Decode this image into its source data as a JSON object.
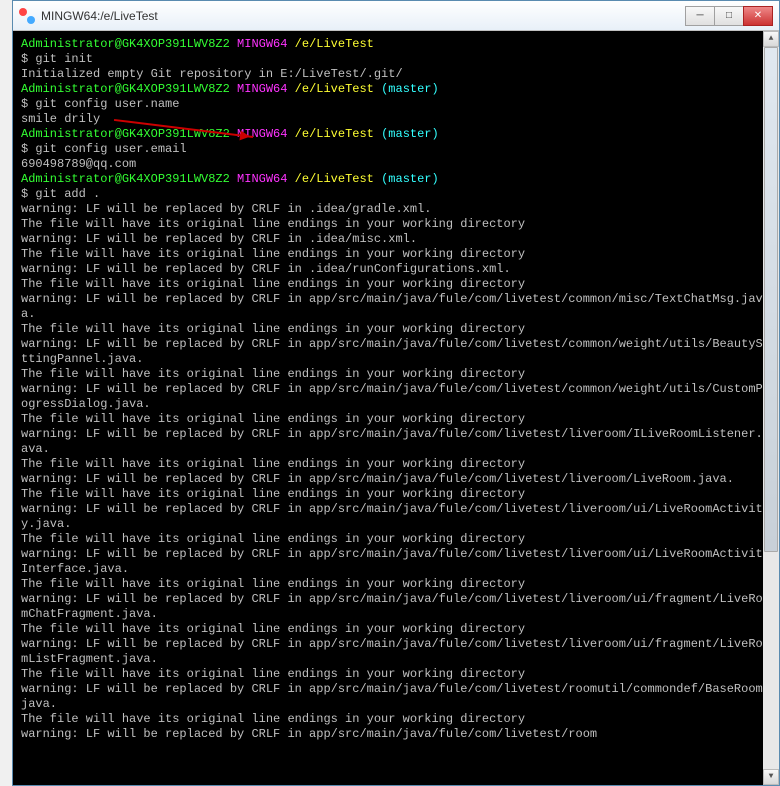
{
  "window": {
    "title": "MINGW64:/e/LiveTest"
  },
  "prompt": {
    "user": "Administrator@GK4XOP391LWV8Z2",
    "shell": "MINGW64",
    "path": "/e/LiveTest",
    "branch": "(master)"
  },
  "blocks": [
    {
      "prompt_branch": false,
      "command": "$ git init",
      "output": [
        "Initialized empty Git repository in E:/LiveTest/.git/"
      ]
    },
    {
      "prompt_branch": true,
      "command": "$ git config user.name",
      "output": [
        "smile drily"
      ]
    },
    {
      "prompt_branch": true,
      "command": "$ git config user.email",
      "output": [
        "690498789@qq.com"
      ]
    },
    {
      "prompt_branch": true,
      "command": "$ git add .",
      "output": [
        "warning: LF will be replaced by CRLF in .idea/gradle.xml.",
        "The file will have its original line endings in your working directory",
        "warning: LF will be replaced by CRLF in .idea/misc.xml.",
        "The file will have its original line endings in your working directory",
        "warning: LF will be replaced by CRLF in .idea/runConfigurations.xml.",
        "The file will have its original line endings in your working directory",
        "warning: LF will be replaced by CRLF in app/src/main/java/fule/com/livetest/common/misc/TextChatMsg.java.",
        "The file will have its original line endings in your working directory",
        "warning: LF will be replaced by CRLF in app/src/main/java/fule/com/livetest/common/weight/utils/BeautySettingPannel.java.",
        "The file will have its original line endings in your working directory",
        "warning: LF will be replaced by CRLF in app/src/main/java/fule/com/livetest/common/weight/utils/CustomProgressDialog.java.",
        "The file will have its original line endings in your working directory",
        "warning: LF will be replaced by CRLF in app/src/main/java/fule/com/livetest/liveroom/ILiveRoomListener.java.",
        "The file will have its original line endings in your working directory",
        "warning: LF will be replaced by CRLF in app/src/main/java/fule/com/livetest/liveroom/LiveRoom.java.",
        "The file will have its original line endings in your working directory",
        "warning: LF will be replaced by CRLF in app/src/main/java/fule/com/livetest/liveroom/ui/LiveRoomActivity.java.",
        "The file will have its original line endings in your working directory",
        "warning: LF will be replaced by CRLF in app/src/main/java/fule/com/livetest/liveroom/ui/LiveRoomActivityInterface.java.",
        "The file will have its original line endings in your working directory",
        "warning: LF will be replaced by CRLF in app/src/main/java/fule/com/livetest/liveroom/ui/fragment/LiveRoomChatFragment.java.",
        "The file will have its original line endings in your working directory",
        "warning: LF will be replaced by CRLF in app/src/main/java/fule/com/livetest/liveroom/ui/fragment/LiveRoomListFragment.java.",
        "The file will have its original line endings in your working directory",
        "warning: LF will be replaced by CRLF in app/src/main/java/fule/com/livetest/roomutil/commondef/BaseRoom.java.",
        "The file will have its original line endings in your working directory",
        "warning: LF will be replaced by CRLF in app/src/main/java/fule/com/livetest/room"
      ]
    }
  ],
  "controls": {
    "minimize": "─",
    "maximize": "□",
    "close": "✕",
    "scroll_up": "▲",
    "scroll_down": "▼"
  }
}
